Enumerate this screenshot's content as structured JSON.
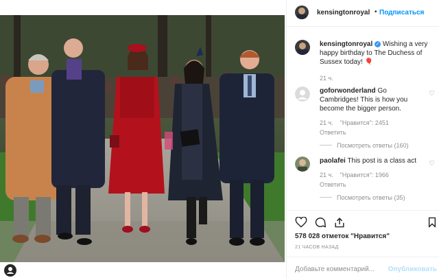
{
  "post": {
    "author": "kensingtonroyal",
    "follow_label": "Подписаться",
    "separator": "•",
    "caption": "Wishing a very happy birthday to The Duchess of Sussex today!",
    "caption_time": "21 ч.",
    "verified_glyph": "✓",
    "heart_emoji": "🎈"
  },
  "comments": [
    {
      "user": "goforwonderland",
      "text": "Go Cambridges! This is how you become the bigger person.",
      "time": "21 ч.",
      "likes": "\"Нравится\": 2451",
      "reply": "Ответить",
      "view_replies": "Посмотреть ответы (160)"
    },
    {
      "user": "paolafei",
      "text": "This post is a class act",
      "time": "21 ч.",
      "likes": "\"Нравится\": 1966",
      "reply": "Ответить",
      "view_replies": "Посмотреть ответы (35)"
    }
  ],
  "stats": {
    "likes_text": "578 028 отметок \"Нравится\"",
    "time_ago": "21 ЧАСОВ НАЗАД"
  },
  "add_comment": {
    "placeholder": "Добавьте комментарий...",
    "publish": "Опубликовать"
  },
  "icons": [
    "heart-icon",
    "comment-icon",
    "share-icon",
    "bookmark-icon",
    "verified-icon",
    "user-icon"
  ],
  "colors": {
    "accent": "#0095f6",
    "muted": "#8e8e8e",
    "border": "#efefef",
    "coat_red": "#b3121c"
  }
}
